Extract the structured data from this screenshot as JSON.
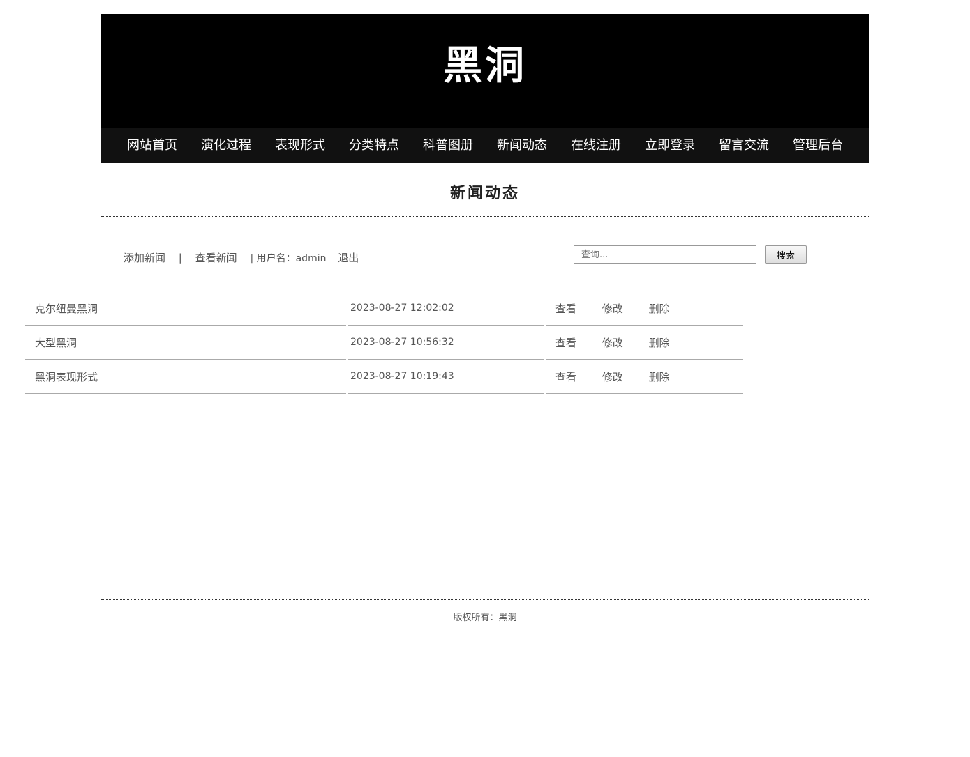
{
  "site": {
    "title": "黑洞"
  },
  "nav": {
    "items": [
      {
        "label": "网站首页"
      },
      {
        "label": "演化过程"
      },
      {
        "label": "表现形式"
      },
      {
        "label": "分类特点"
      },
      {
        "label": "科普图册"
      },
      {
        "label": "新闻动态"
      },
      {
        "label": "在线注册"
      },
      {
        "label": "立即登录"
      },
      {
        "label": "留言交流"
      },
      {
        "label": "管理后台"
      }
    ]
  },
  "page": {
    "title": "新闻动态"
  },
  "toolbar": {
    "add_news": "添加新闻",
    "separator": "|",
    "view_news": "查看新闻",
    "user_label": "| 用户名：admin",
    "logout": "退出",
    "search_placeholder": "查询...",
    "search_button": "搜索"
  },
  "news": {
    "rows": [
      {
        "title": "克尔纽曼黑洞",
        "time": "2023-08-27 12:02:02",
        "view": "查看",
        "edit": "修改",
        "delete": "删除"
      },
      {
        "title": "大型黑洞",
        "time": "2023-08-27 10:56:32",
        "view": "查看",
        "edit": "修改",
        "delete": "删除"
      },
      {
        "title": "黑洞表现形式",
        "time": "2023-08-27 10:19:43",
        "view": "查看",
        "edit": "修改",
        "delete": "删除"
      }
    ]
  },
  "footer": {
    "copyright": "版权所有：黑洞"
  },
  "colors": {
    "banner": "#000000",
    "nav": "#111111",
    "text": "#555555"
  }
}
